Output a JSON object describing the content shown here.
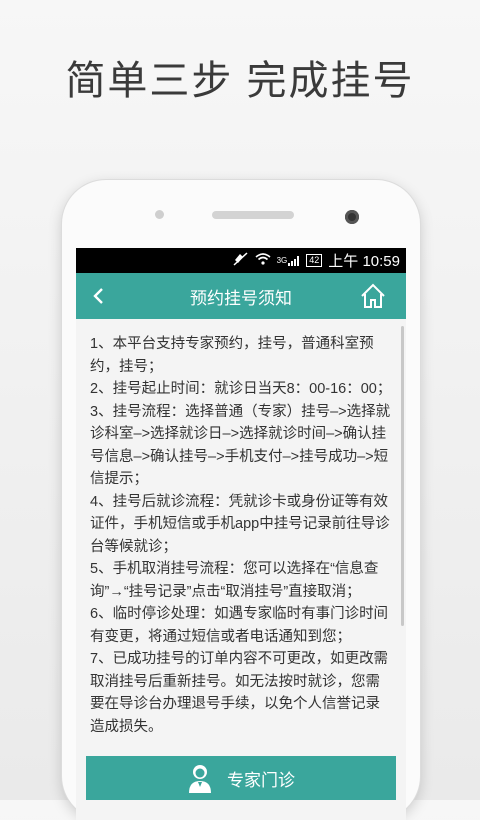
{
  "headline": "简单三步 完成挂号",
  "status_bar": {
    "time": "上午 10:59",
    "icons": [
      "mute-icon",
      "wifi-icon",
      "signal-3g-icon",
      "battery-icon"
    ],
    "net_label": "3G",
    "battery_label": "42"
  },
  "app_bar": {
    "title": "预约挂号须知",
    "back_icon": "back-icon",
    "home_icon": "home-icon"
  },
  "notice": [
    "1、本平台支持专家预约，挂号，普通科室预约，挂号；",
    "2、挂号起止时间：就诊日当天8：00-16：00；",
    "3、挂号流程：选择普通（专家）挂号–>选择就诊科室–>选择就诊日–>选择就诊时间–>确认挂号信息–>确认挂号–>手机支付–>挂号成功–>短信提示；",
    "4、挂号后就诊流程：凭就诊卡或身份证等有效证件，手机短信或手机app中挂号记录前往导诊台等候就诊；",
    "5、手机取消挂号流程：您可以选择在“信息查询”→“挂号记录”点击“取消挂号”直接取消；",
    "6、临时停诊处理：如遇专家临时有事门诊时间有变更，将通过短信或者电话通知到您；",
    "7、已成功挂号的订单内容不可更改，如更改需取消挂号后重新挂号。如无法按时就诊，您需要在导诊台办理退号手续，以免个人信誉记录造成损失。"
  ],
  "bottom_button": {
    "label": "专家门诊",
    "icon": "doctor-icon"
  },
  "colors": {
    "accent": "#3aa69c",
    "headline": "#3a3a3a"
  }
}
